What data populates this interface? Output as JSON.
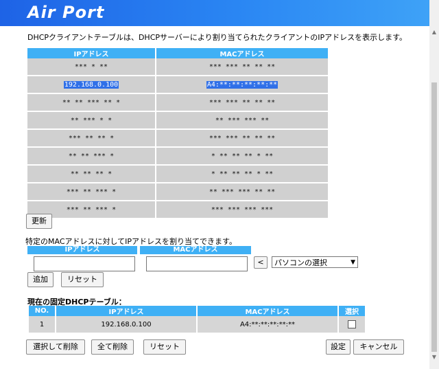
{
  "header": {
    "logo": "Air Port"
  },
  "intro_text": "DHCPクライアントテーブルは、DHCPサーバーにより割り当てられたクライアントのIPアドレスを表示します。",
  "clients": {
    "columns": [
      "IPアドレス",
      "MACアドレス"
    ],
    "rows": [
      {
        "ip": "*** * **",
        "mac": "*** *** ** ** **"
      },
      {
        "ip": "192.168.0.100",
        "mac": "A4:**:**:**:**:**"
      },
      {
        "ip": "** ** *** ** *",
        "mac": "*** *** ** ** **"
      },
      {
        "ip": "** *** * *",
        "mac": "** *** *** **"
      },
      {
        "ip": "*** ** ** *",
        "mac": "*** *** ** ** **"
      },
      {
        "ip": "** ** *** *",
        "mac": "* ** ** ** * **"
      },
      {
        "ip": "** ** ** *",
        "mac": "* ** ** ** * **"
      },
      {
        "ip": "*** ** *** *",
        "mac": "** *** *** ** **"
      },
      {
        "ip": "*** ** *** *",
        "mac": "*** *** *** ***"
      }
    ]
  },
  "refresh_label": "更新",
  "assign_text": "特定のMACアドレスに対してIPアドレスを割り当てできます。",
  "assign": {
    "ip_header": "IPアドレス",
    "mac_header": "MACアドレス",
    "ip_value": "",
    "mac_value": "",
    "arrow_label": "<",
    "select_value": "パソコンの選択",
    "add_label": "追加",
    "reset_label": "リセット"
  },
  "fixed_title": "現在の固定DHCPテーブル：",
  "fixed": {
    "columns": [
      "NO.",
      "IPアドレス",
      "MACアドレス",
      "選択"
    ],
    "rows": [
      {
        "no": "1",
        "ip": "192.168.0.100",
        "mac": "A4:**:**:**:**:**"
      }
    ]
  },
  "footer": {
    "delete_selected": "選択して削除",
    "delete_all": "全て削除",
    "reset": "リセット",
    "apply": "設定",
    "cancel": "キャンセル"
  },
  "colors": {
    "header_blue": "#1e63e6",
    "table_header": "#3fb0f5",
    "selection": "#3070e8"
  }
}
